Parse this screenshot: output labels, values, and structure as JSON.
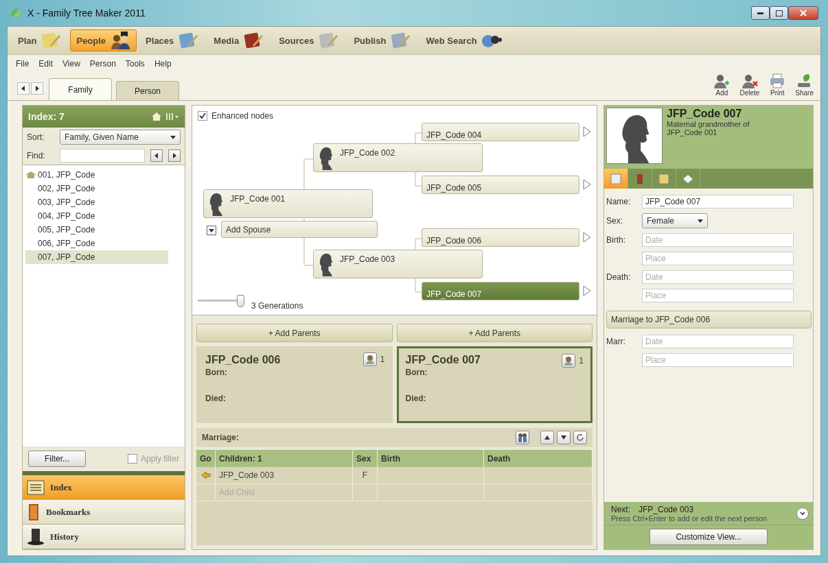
{
  "window": {
    "title": "X - Family Tree Maker 2011"
  },
  "modules": [
    {
      "label": "Plan",
      "selected": false
    },
    {
      "label": "People",
      "selected": true
    },
    {
      "label": "Places",
      "selected": false
    },
    {
      "label": "Media",
      "selected": false
    },
    {
      "label": "Sources",
      "selected": false
    },
    {
      "label": "Publish",
      "selected": false
    },
    {
      "label": "Web Search",
      "selected": false
    }
  ],
  "menu": [
    "File",
    "Edit",
    "View",
    "Person",
    "Tools",
    "Help"
  ],
  "view_tabs": [
    {
      "label": "Family",
      "selected": true
    },
    {
      "label": "Person",
      "selected": false
    }
  ],
  "toolbar": [
    {
      "kind": "add",
      "label": "Add"
    },
    {
      "kind": "delete",
      "label": "Delete"
    },
    {
      "kind": "print",
      "label": "Print"
    },
    {
      "kind": "share",
      "label": "Share"
    }
  ],
  "index_panel": {
    "title": "Index: 7",
    "sort_label": "Sort:",
    "sort_value": "Family, Given Name",
    "find_label": "Find:",
    "items": [
      {
        "label": "001, JFP_Code",
        "home": true,
        "selected": false
      },
      {
        "label": "002, JFP_Code",
        "home": false,
        "selected": false
      },
      {
        "label": "003, JFP_Code",
        "home": false,
        "selected": false
      },
      {
        "label": "004, JFP_Code",
        "home": false,
        "selected": false
      },
      {
        "label": "005, JFP_Code",
        "home": false,
        "selected": false
      },
      {
        "label": "006, JFP_Code",
        "home": false,
        "selected": false
      },
      {
        "label": "007, JFP_Code",
        "home": false,
        "selected": true
      }
    ],
    "filter_button": "Filter...",
    "apply_filter": {
      "label": "Apply filter",
      "checked": false
    }
  },
  "side_nav": [
    {
      "kind": "index",
      "label": "Index",
      "selected": true
    },
    {
      "kind": "bookmarks",
      "label": "Bookmarks",
      "selected": false
    },
    {
      "kind": "history",
      "label": "History",
      "selected": false
    }
  ],
  "tree": {
    "enhanced_nodes": {
      "label": "Enhanced nodes",
      "checked": true
    },
    "nodes": [
      {
        "name": "JFP_Code 001",
        "kind": "root",
        "selected": false
      },
      {
        "name": "JFP_Code 002",
        "kind": "parent",
        "selected": false
      },
      {
        "name": "JFP_Code 003",
        "kind": "parent",
        "selected": false
      },
      {
        "name": "JFP_Code 004",
        "kind": "grandparent",
        "selected": false
      },
      {
        "name": "JFP_Code 005",
        "kind": "grandparent",
        "selected": false
      },
      {
        "name": "JFP_Code 006",
        "kind": "grandparent",
        "selected": false
      },
      {
        "name": "JFP_Code 007",
        "kind": "grandparent",
        "selected": true
      }
    ],
    "add_spouse": "Add Spouse",
    "generations": {
      "label": "3 Generations",
      "level": 1
    }
  },
  "family": {
    "couple": [
      {
        "add_parents": "+ Add Parents",
        "name": "JFP_Code 006",
        "born_label": "Born:",
        "died_label": "Died:",
        "children_count": "1",
        "selected": false
      },
      {
        "add_parents": "+ Add Parents",
        "name": "JFP_Code 007",
        "born_label": "Born:",
        "died_label": "Died:",
        "children_count": "1",
        "selected": true
      }
    ],
    "marriage_label": "Marriage:",
    "columns": [
      "Go",
      "Children: 1",
      "Sex",
      "Birth",
      "Death"
    ],
    "rows": [
      {
        "kind": "child",
        "name": "JFP_Code 003",
        "sex": "F"
      },
      {
        "kind": "add",
        "name": "Add Child"
      }
    ]
  },
  "person": {
    "name": "JFP_Code 007",
    "relation": "Maternal grandmother of",
    "relation_target": "JFP_Code 001",
    "tabs": [
      {
        "kind": "edit",
        "selected": true
      },
      {
        "kind": "media",
        "selected": false
      },
      {
        "kind": "notes",
        "selected": false
      },
      {
        "kind": "tasks",
        "selected": false
      }
    ],
    "fields": [
      {
        "kind": "text",
        "label": "Name:",
        "value": "JFP_Code 007"
      },
      {
        "kind": "select",
        "label": "Sex:",
        "value": "Female"
      },
      {
        "kind": "event",
        "label": "Birth:",
        "date_placeholder": "Date",
        "place_placeholder": "Place"
      },
      {
        "kind": "event",
        "label": "Death:",
        "date_placeholder": "Date",
        "place_placeholder": "Place"
      }
    ],
    "marriage": {
      "title": "Marriage to JFP_Code 006",
      "label": "Marr:",
      "date_placeholder": "Date",
      "place_placeholder": "Place"
    },
    "next": {
      "label": "Next:",
      "value": "JFP_Code 003",
      "hint": "Press Ctrl+Enter to add or edit the next person"
    },
    "customize_button": "Customize View..."
  }
}
